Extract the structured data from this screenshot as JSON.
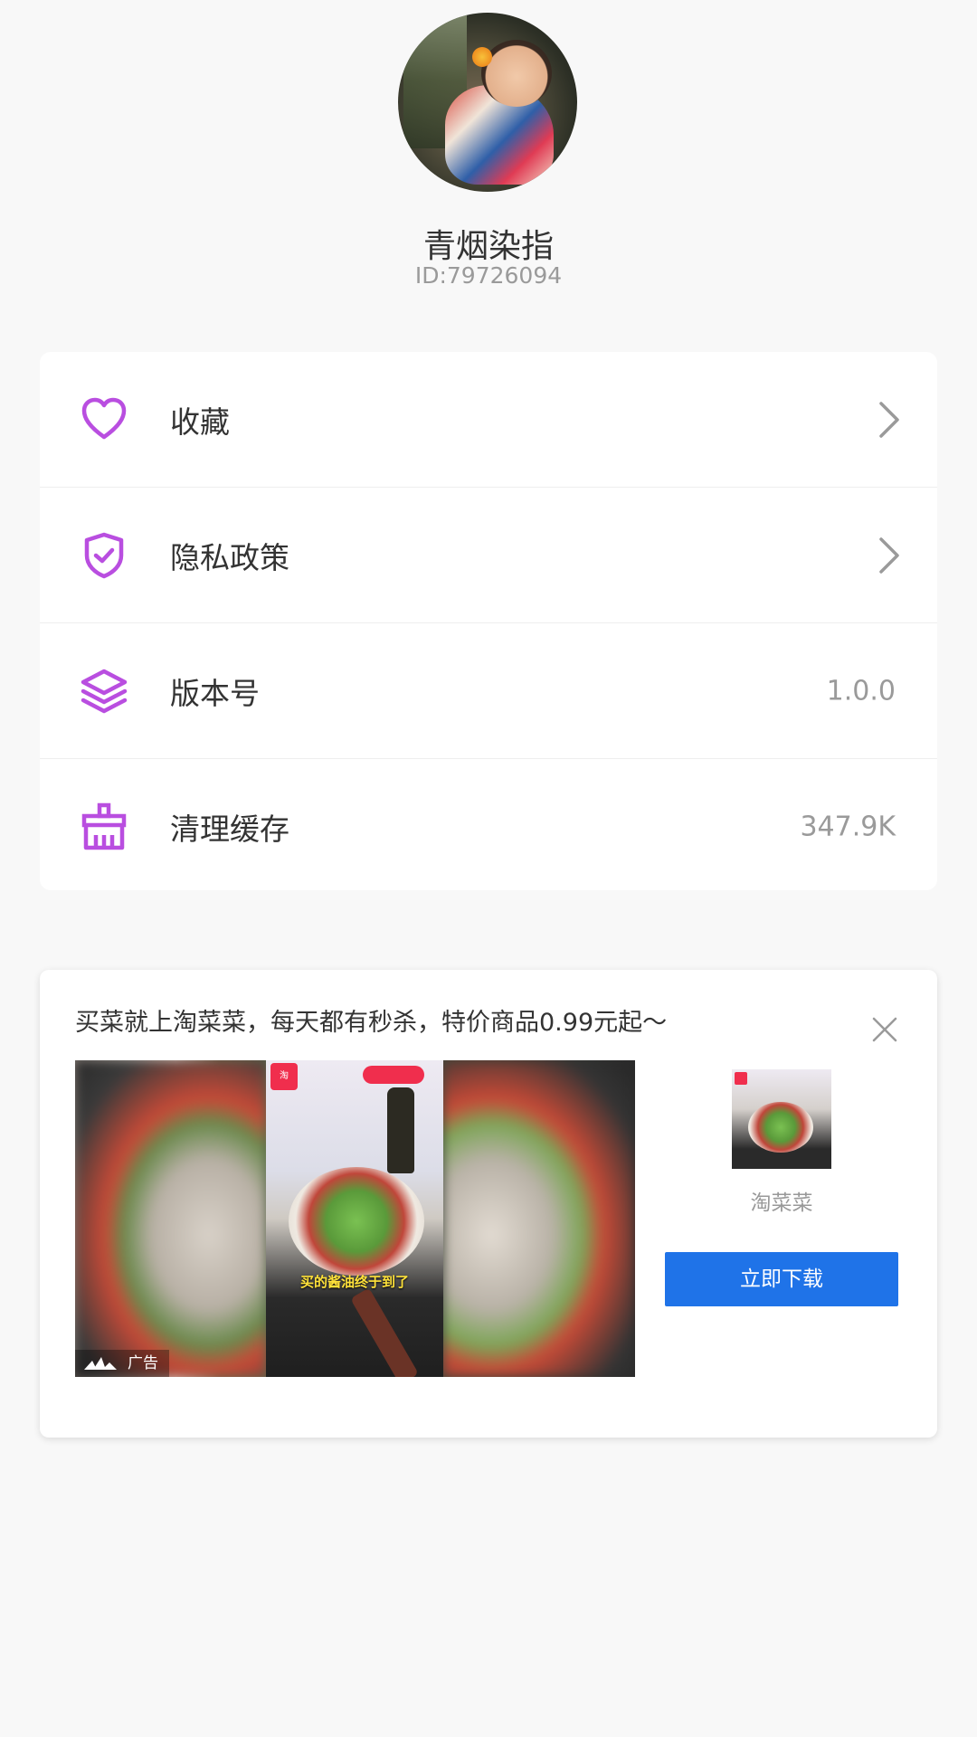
{
  "profile": {
    "username": "青烟染指",
    "user_id": "ID:79726094"
  },
  "menu": {
    "items": [
      {
        "label": "收藏",
        "icon": "heart-icon",
        "value": ""
      },
      {
        "label": "隐私政策",
        "icon": "shield-check-icon",
        "value": ""
      },
      {
        "label": "版本号",
        "icon": "layers-icon",
        "value": "1.0.0"
      },
      {
        "label": "清理缓存",
        "icon": "brush-icon",
        "value": "347.9K"
      }
    ]
  },
  "ad": {
    "title": "买菜就上淘菜菜，每天都有秒杀，特价商品0.99元起～",
    "image_caption": "买的酱油终于到了",
    "brand_tag": "淘",
    "badge_label": "广告",
    "app_name": "淘菜菜",
    "download_label": "立即下载"
  },
  "colors": {
    "accent": "#b94ee0",
    "button_blue": "#1f73e8",
    "background": "#f8f8f8"
  }
}
